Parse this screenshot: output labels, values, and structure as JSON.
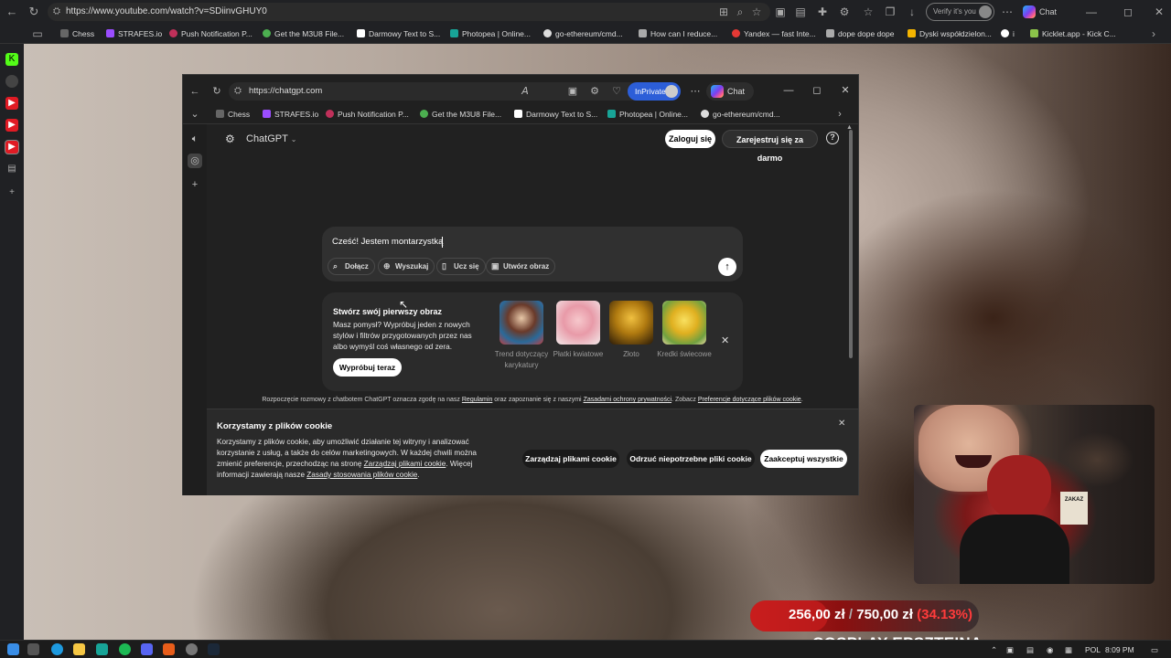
{
  "outer_browser": {
    "url": "https://www.youtube.com/watch?v=SDiinvGHUY0",
    "verify_label": "Verify it's you",
    "chat_label": "Chat",
    "bookmarks": [
      "Chess",
      "STRAFES.io",
      "Push Notification P...",
      "Get the M3U8 File...",
      "Darmowy Text to S...",
      "Photopea | Online...",
      "go-ethereum/cmd...",
      "How can I reduce...",
      "Yandex — fast Inte...",
      "dope dope dope",
      "Dyski współdzielon...",
      "i",
      "Kicklet.app - Kick C..."
    ]
  },
  "inner_browser": {
    "url": "https://chatgpt.com",
    "inprivate_label": "InPrivate",
    "chat_label": "Chat",
    "bookmarks": [
      "Chess",
      "STRAFES.io",
      "Push Notification P...",
      "Get the M3U8 File...",
      "Darmowy Text to S...",
      "Photopea | Online...",
      "go-ethereum/cmd..."
    ]
  },
  "chatgpt": {
    "model_label": "ChatGPT",
    "login_label": "Zaloguj się",
    "signup_label": "Zarejestruj się za darmo",
    "composer_text": "Cześć! Jestem montarzystką",
    "composer_buttons": [
      "Dołącz",
      "Wyszukaj",
      "Ucz się",
      "Utwórz obraz"
    ],
    "promo": {
      "title": "Stwórz swój pierwszy obraz",
      "body": "Masz pomysł? Wypróbuj jeden z nowych stylów i filtrów przygotowanych przez nas albo wymyśl coś własnego od zera.",
      "cta": "Wypróbuj teraz",
      "styles": [
        "Trend dotyczący karykatury",
        "Płatki kwiatowe",
        "Złoto",
        "Kredki świecowe"
      ]
    },
    "terms": {
      "prefix": "Rozpoczęcie rozmowy z chatbotem ChatGPT oznacza zgodę na nasz ",
      "link1": "Regulamin",
      "mid": " oraz zapoznanie się z naszymi ",
      "link2": "Zasadami ochrony prywatności",
      "mid2": ". Zobacz ",
      "link3": "Preferencje dotyczące plików cookie",
      "suffix": "."
    },
    "cookie": {
      "title": "Korzystamy z plików cookie",
      "body1": "Korzystamy z plików cookie, aby umożliwić działanie tej witryny i analizować korzystanie z usług, a także do celów marketingowych. W każdej chwili można zmienić preferencje, przechodząc na stronę ",
      "link1": "Zarządzaj plikami cookie",
      "body2": ". Więcej informacji zawierają nasze ",
      "link2": "Zasady stosowania plików cookie",
      "body3": ".",
      "manage_label": "Zarządzaj plikami cookie",
      "reject_label": "Odrzuć niepotrzebne pliki cookie",
      "accept_label": "Zaakceptuj wszystkie"
    }
  },
  "overlay": {
    "donation_current": "256,00 zł",
    "donation_sep": "/",
    "donation_goal": "750,00 zł",
    "donation_pct": "(34.13%)",
    "donation_progress_percent": 34.13,
    "title": "COSPLAY EPSZTEINA"
  },
  "webcam": {
    "sign_text": "ZAKAZ"
  },
  "taskbar": {
    "lang": "POL",
    "time": "8:09 PM"
  },
  "colors": {
    "inprivate": "#2c5ed8",
    "donation_red": "#b81b1b",
    "donation_pct": "#ff3b3b"
  }
}
